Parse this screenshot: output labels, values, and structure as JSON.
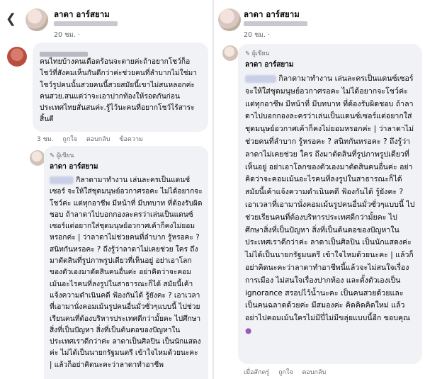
{
  "left": {
    "post": {
      "author": "ลาดา อาร์สยาม",
      "time": "20 ชม.",
      "back_icon": "chevron-left-icon"
    },
    "comment": {
      "text": "คนไทยบ้างคนเดือดร้อนจะตายค่ะถ้าอยากโชว์ก็อโชว์ที่สังคมเห็นกันดีกว่าค่ะช่วยคนที่ลำบากไม่ใช่มาโชว์รูปคนนั้นสวยคนนี้สวยสมัยนี้เขาไม่สนหลอกค่ะคนสวย.สนแต่ว่าจะเอาปากท้องให้รอดกันก่อนประเทศไทยสั่นสนค่ะ.รู้ไว้นะคนที่อยากโชว์ไร้สาระสิ้นดี",
      "time": "3 ชม.",
      "like": "ถูกใจ",
      "reply": "ตอบกลับ",
      "report": "ข้อความ"
    },
    "reply": {
      "badge": "ผู้เขียน",
      "author": "ลาดา อาร์สยาม",
      "text": "กิลาดามาทำงาน เล่นละครเป็นแดนซ์เซอร์ จะให้ใส่ชุดมนุษย์อวกาศรอคะ ไม่ได้อยากจะโชว์ค่ะ แต่ทุกอาชีพ มีหน้าที่ มีบทบาท ที่ต้องรับผิดชอบ ถ้าลาดาไปบอกกองละครว่าเล่นเป็นแดนซ์เซอร์แต่อยากใส่ชุดมนุษย์อวกาศเค้าก็คงไม่ยอมหรอกค่ะ | ว่าลาดาไม่ช่วยคนที่ลำบาก รู้หรอคะ ? สนิทกันหรอคะ ? ถึงรู้ว่าลาดาไม่เคยช่วย ใคร ถึงมาตัดสินที่รูปภาพรูปเดียวที่เห็นอยู่ อย่าเอาโลกของตัวเองมาตัดสินคนอื่นค่ะ อย่าคิดว่าจะคอมเม้นอะไรคนที่ลงรูปในสาธารณะก็ได้ สมัยนี้เค้าแจ้งความดำเนินคดี ฟ้องกันได้ รู้ยังคะ ? เอาเวลาที่เอามานั่งคอมเม้นรูปคนอื่นมั่วซั่วๆแบบนี้ ไปช่วยเรียนคนที่ต้องบริหารประเทศดีกว่ามั้ยคะ ไปศึกษาสิ่งที่เป็นปัญหา สิ่งที่เป็นต้นตอของปัญหาในประเทศเราดีกว่าค่ะ ลาดาเป็นศิลปิน เป็นนักแสดงค่ะ ไม่ได้เป็นนายกรัฐมนตรี เข้าใจไหมด้วยนะคะ | แล้วก็อย่าคิดนะคะว่าลาดาทำอาชีพ"
    }
  },
  "right": {
    "post": {
      "author": "ลาดา อาร์สยาม",
      "time": "20 ชม."
    },
    "reply": {
      "badge": "ผู้เขียน",
      "author": "ลาดา อาร์สยาม",
      "text": "กิลาดามาทำงาน เล่นละครเป็นแดนซ์เซอร์ จะให้ใส่ชุดมนุษย์อวกาศรอคะ ไม่ได้อยากจะโชว์ค่ะ แต่ทุกอาชีพ มีหน้าที่ มีบทบาท ที่ต้องรับผิดชอบ ถ้าลาดาไปบอกกองละครว่าเล่นเป็นแดนซ์เซอร์แต่อยากใส่ชุดมนุษย์อวกาศเค้าก็คงไม่ยอมหรอกค่ะ | ว่าลาดาไม่ช่วยคนที่ลำบาก รู้หรอคะ ? สนิทกันหรอคะ ? ถึงรู้ว่าลาดาไม่เคยช่วย ใคร ถึงมาตัดสินที่รูปภาพรูปเดียวที่เห็นอยู่ อย่าเอาโลกของตัวเองมาตัดสินคนอื่นค่ะ อย่าคิดว่าจะคอมเม้นอะไรคนที่ลงรูปในสาธารณะก็ได้ สมัยนี้เค้าแจ้งความดำเนินคดี ฟ้องกันได้ รู้ยังคะ ? เอาเวลาที่เอามานั่งคอมเม้นรูปคนอื่นมั่วซั่วๆแบบนี้ ไปช่วยเรียนคนที่ต้องบริหารประเทศดีกว่ามั้ยคะ ไปศึกษาสิ่งที่เป็นปัญหา สิ่งที่เป็นต้นตอของปัญหาในประเทศเราดีกว่าค่ะ ลาดาเป็นศิลปิน เป็นนักแสดงค่ะ ไม่ได้เป็นนายกรัฐมนตรี เข้าใจไหมด้วยนะคะ | แล้วก็อย่าคิดนะคะว่าลาดาทำอาชีพนี้แล้วจะไม่สนใจเรื่องการเมือง ไม่สนใจเรื่องปากท้อง และตั้งตัวเองเป็น ignorance สรอปไว้น้ำนะคะ เป็นคนสวยด้วยและเป็นคนฉลาดด้วยค่ะ มีสมองค่ะ คิดคิดคิดใหม่ แล้วอย่าไปคอมเม้นใครไม่มีปี่ไม่มีขลุ่ยแบบนี้อีก ขอบคุณ",
      "time": "เมื่อสักครู่",
      "like": "ถูกใจ",
      "reply": "ตอบกลับ"
    }
  }
}
